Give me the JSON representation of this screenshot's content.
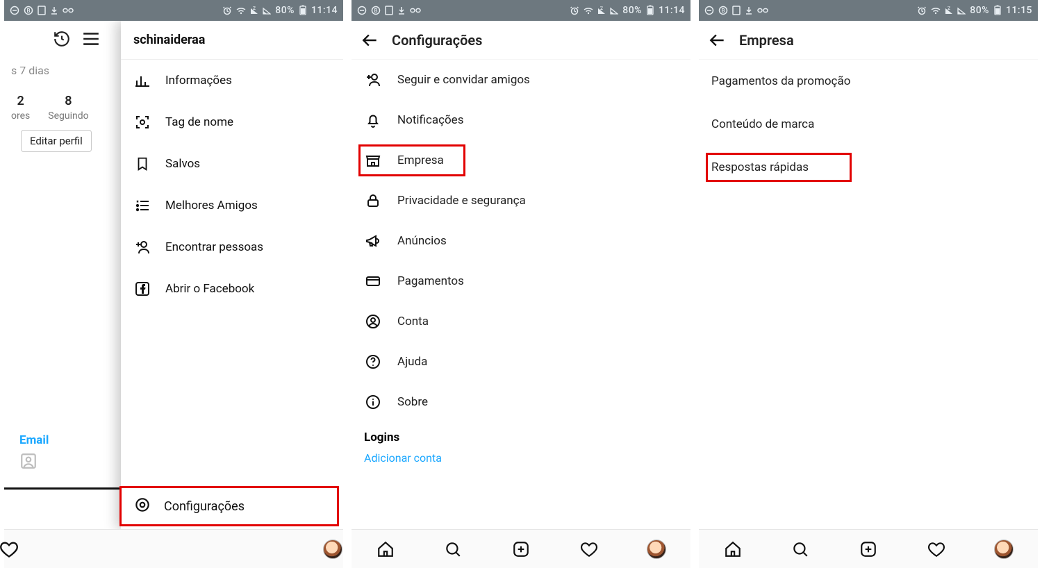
{
  "statusbar": {
    "battery": "80%",
    "clock_a": "11:14",
    "clock_b": "11:15"
  },
  "p1": {
    "username": "schinaideraa",
    "period": "s 7 dias",
    "stat_a_num": "2",
    "stat_a_cap": "ores",
    "stat_b_num": "8",
    "stat_b_cap": "Seguindo",
    "edit_profile": "Editar perfil",
    "email": "Email",
    "menu": {
      "insights": "Informações",
      "nametag": "Tag de nome",
      "saved": "Salvos",
      "closef": "Melhores Amigos",
      "discover": "Encontrar pessoas",
      "openfb": "Abrir o Facebook",
      "settings": "Configurações"
    }
  },
  "p2": {
    "header": "Configurações",
    "items": {
      "follow": "Seguir e convidar amigos",
      "notif": "Notificações",
      "business": "Empresa",
      "privacy": "Privacidade e segurança",
      "ads": "Anúncios",
      "payments": "Pagamentos",
      "account": "Conta",
      "help": "Ajuda",
      "about": "Sobre"
    },
    "logins_heading": "Logins",
    "add_account": "Adicionar conta"
  },
  "p3": {
    "header": "Empresa",
    "items": {
      "promo_pay": "Pagamentos da promoção",
      "branded": "Conteúdo de marca",
      "quick_replies": "Respostas rápidas"
    }
  }
}
